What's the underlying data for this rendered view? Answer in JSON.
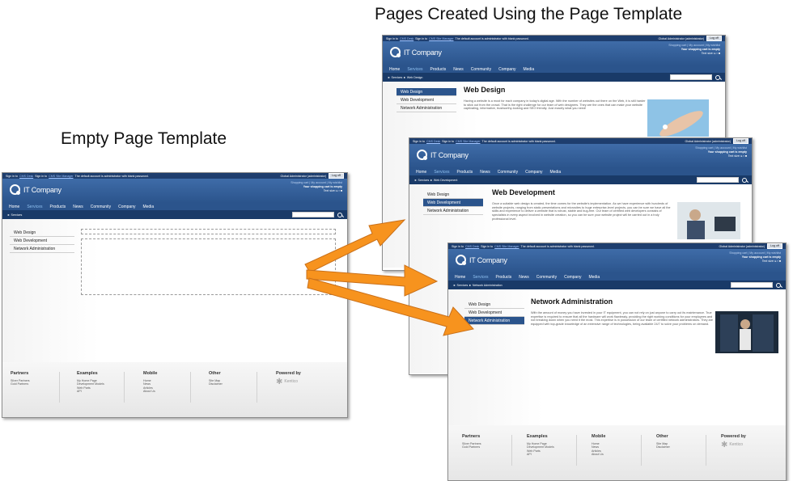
{
  "titles": {
    "created": "Pages Created Using the Page Template",
    "empty": "Empty Page Template"
  },
  "site": {
    "topbar": {
      "sign_in_1": "Sign in to",
      "cms_desk": "CMS Desk",
      "sign_in_2": "Sign in to",
      "site_manager": "CMS Site Manager",
      "default_note": "The default account is administrator with blank password.",
      "user": "Global Administrator (administrator)",
      "logout": "Log off"
    },
    "logo": "IT Company",
    "header": {
      "links": "Shopping cart | My account | My wishlist",
      "cart": "Your shopping cart is empty",
      "textsize": "Text size: ▸ ▪ ■"
    },
    "nav": [
      "Home",
      "Services",
      "Products",
      "News",
      "Community",
      "Company",
      "Media"
    ],
    "active_nav": "Services",
    "sidenav": [
      "Web Design",
      "Web Development",
      "Network Administration"
    ],
    "footer": {
      "partners": {
        "title": "Partners",
        "items": [
          "Silver Partners",
          "Gold Partners"
        ]
      },
      "examples": {
        "title": "Examples",
        "items": [
          "My Home Page",
          "Development Models",
          "Web Parts",
          "API"
        ]
      },
      "mobile": {
        "title": "Mobile",
        "items": [
          "Home",
          "News",
          "Articles",
          "About Us"
        ]
      },
      "other": {
        "title": "Other",
        "items": [
          "Site Map",
          "Disclaimer"
        ]
      },
      "powered": {
        "title": "Powered by",
        "brand": "Kentico"
      }
    }
  },
  "pages": {
    "empty": {
      "breadcrumb": "► Services"
    },
    "design": {
      "breadcrumb": "► Services ► Web Design",
      "heading": "Web Design",
      "text": "Having a website is a must for each company in today's digital age. With the number of websites out there on the Web, it is still harder to stick out from the crowd. That is the right challenge for our team of web designers. They are the ones that can make your website captivating, informative, trustworthy-looking and SEO friendly. Just exactly what you need!"
    },
    "development": {
      "breadcrumb": "► Services ► Web Development",
      "heading": "Web Development",
      "text": "Once a suitable web design is created, the time comes for the website's implementation. As we have experience with hundreds of website projects, ranging from static presentations and microsites to huge enterprise-level projects, you can be sure we have all the skills and experience to deliver a website that is robust, stable and bug-free. Our team of certified web developers consists of specialists in every aspect involved in website creation, so you can be sure your website project will be carried out in a truly professional level."
    },
    "network": {
      "breadcrumb": "► Services ► Network Administration",
      "heading": "Network Administration",
      "text": "With the amount of money you have invested in your IT equipment, you can not rely on just anyone to carry out its maintenance. True expertise is required to ensure that all the hardware will work flawlessly, providing the right working conditions for your employees and not breaking down when you need it the most. This expertise is in possession of our team of certified network administrators. They are equipped with top-grade knowledge of an extensive range of technologies, being available 24/7 to solve your problems on demand."
    }
  }
}
